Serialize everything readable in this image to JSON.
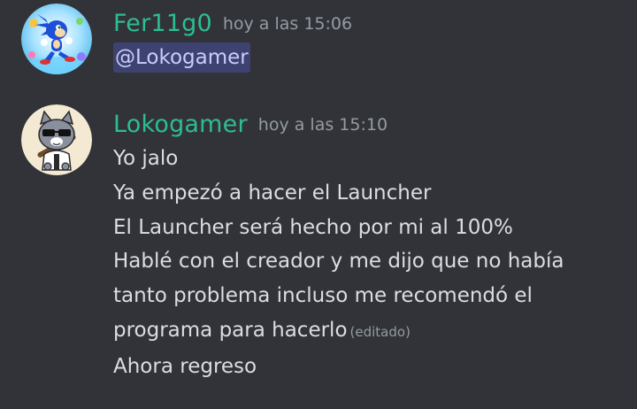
{
  "messages": [
    {
      "author": "Fer11g0",
      "timestamp": "hoy a las 15:06",
      "mention": "@Lokogamer",
      "avatar_icon": "sonic-avatar-icon"
    },
    {
      "author": "Lokogamer",
      "timestamp": "hoy a las 15:10",
      "lines": [
        "Yo jalo",
        "Ya empezó a hacer el Launcher",
        "El Launcher será hecho por mi al 100%",
        "Hablé con el creador y me dijo que no había",
        "tanto problema incluso me recomendó el",
        "programa para hacerlo",
        "Ahora regreso"
      ],
      "edited_label": "(editado)",
      "avatar_icon": "cat-sunglasses-avatar-icon"
    }
  ],
  "colors": {
    "background": "#313338",
    "username": "#2ebc94",
    "timestamp": "#949ba4",
    "text": "#dbdee1",
    "mention_bg": "#3e4270",
    "mention_text": "#c9cdfb"
  }
}
